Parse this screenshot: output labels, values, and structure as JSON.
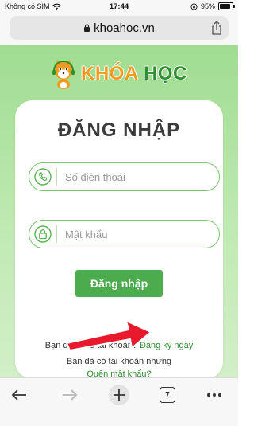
{
  "status": {
    "carrier": "Không có SIM",
    "time": "17:44",
    "battery": "95%"
  },
  "browser": {
    "url": "khoahoc.vn",
    "tab_count": "7"
  },
  "logo": {
    "part1": "KHÓA",
    "part2": "HỌC"
  },
  "login": {
    "title": "ĐĂNG NHẬP",
    "phone_placeholder": "Số điện thoại",
    "password_placeholder": "Mật khẩu",
    "submit_label": "Đăng nhập",
    "no_account_text": "Bạn chưa có tài khoản?",
    "signup_label": "Đăng ký ngay",
    "have_account_text": "Bạn đã có tài khoản nhưng",
    "forgot_label": "Quên mật khẩu?"
  },
  "colors": {
    "accent_green": "#4cab4c",
    "annotation_arrow": "#e8192c"
  }
}
